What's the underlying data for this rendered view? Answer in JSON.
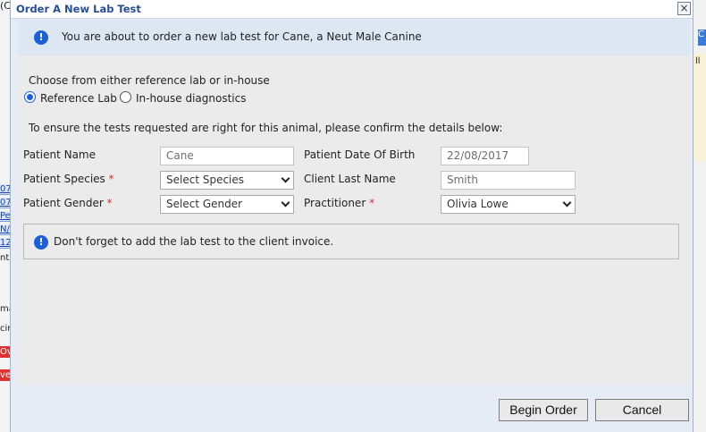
{
  "background": {
    "top_left_fragment": "(C",
    "left_fragments": [
      "07",
      "07",
      "Pe",
      "N/",
      "12",
      "nt",
      "ma",
      "cir",
      "Ov",
      "ve"
    ],
    "right_fragment": "ll",
    "right_button_fragment": "C"
  },
  "dialog": {
    "title": "Order A New Lab Test",
    "close_label": "×",
    "banner_text": "You are about to order a new lab test for Cane, a Neut Male Canine",
    "choose_text": "Choose from either reference lab or in-house",
    "options": [
      {
        "label": "Reference Lab",
        "checked": true
      },
      {
        "label": "In-house diagnostics",
        "checked": false
      }
    ],
    "confirm_text": "To ensure the tests requested are right for this animal, please confirm the details below:",
    "required_marker": "*",
    "fields": {
      "patient_name": {
        "label": "Patient Name",
        "value": "Cane"
      },
      "patient_dob": {
        "label": "Patient Date Of Birth",
        "value": "22/08/2017"
      },
      "patient_species": {
        "label": "Patient Species",
        "value": "Select Species"
      },
      "client_last_name": {
        "label": "Client Last Name",
        "value": "Smith"
      },
      "patient_gender": {
        "label": "Patient Gender",
        "value": "Select Gender"
      },
      "practitioner": {
        "label": "Practitioner",
        "value": "Olivia Lowe"
      }
    },
    "reminder_text": "Don't forget to add the lab test to the client invoice.",
    "info_glyph": "!",
    "buttons": {
      "begin": "Begin Order",
      "cancel": "Cancel"
    }
  },
  "colors": {
    "accent": "#1f5fd6",
    "title": "#2a4d8f",
    "required": "#d0312d"
  }
}
